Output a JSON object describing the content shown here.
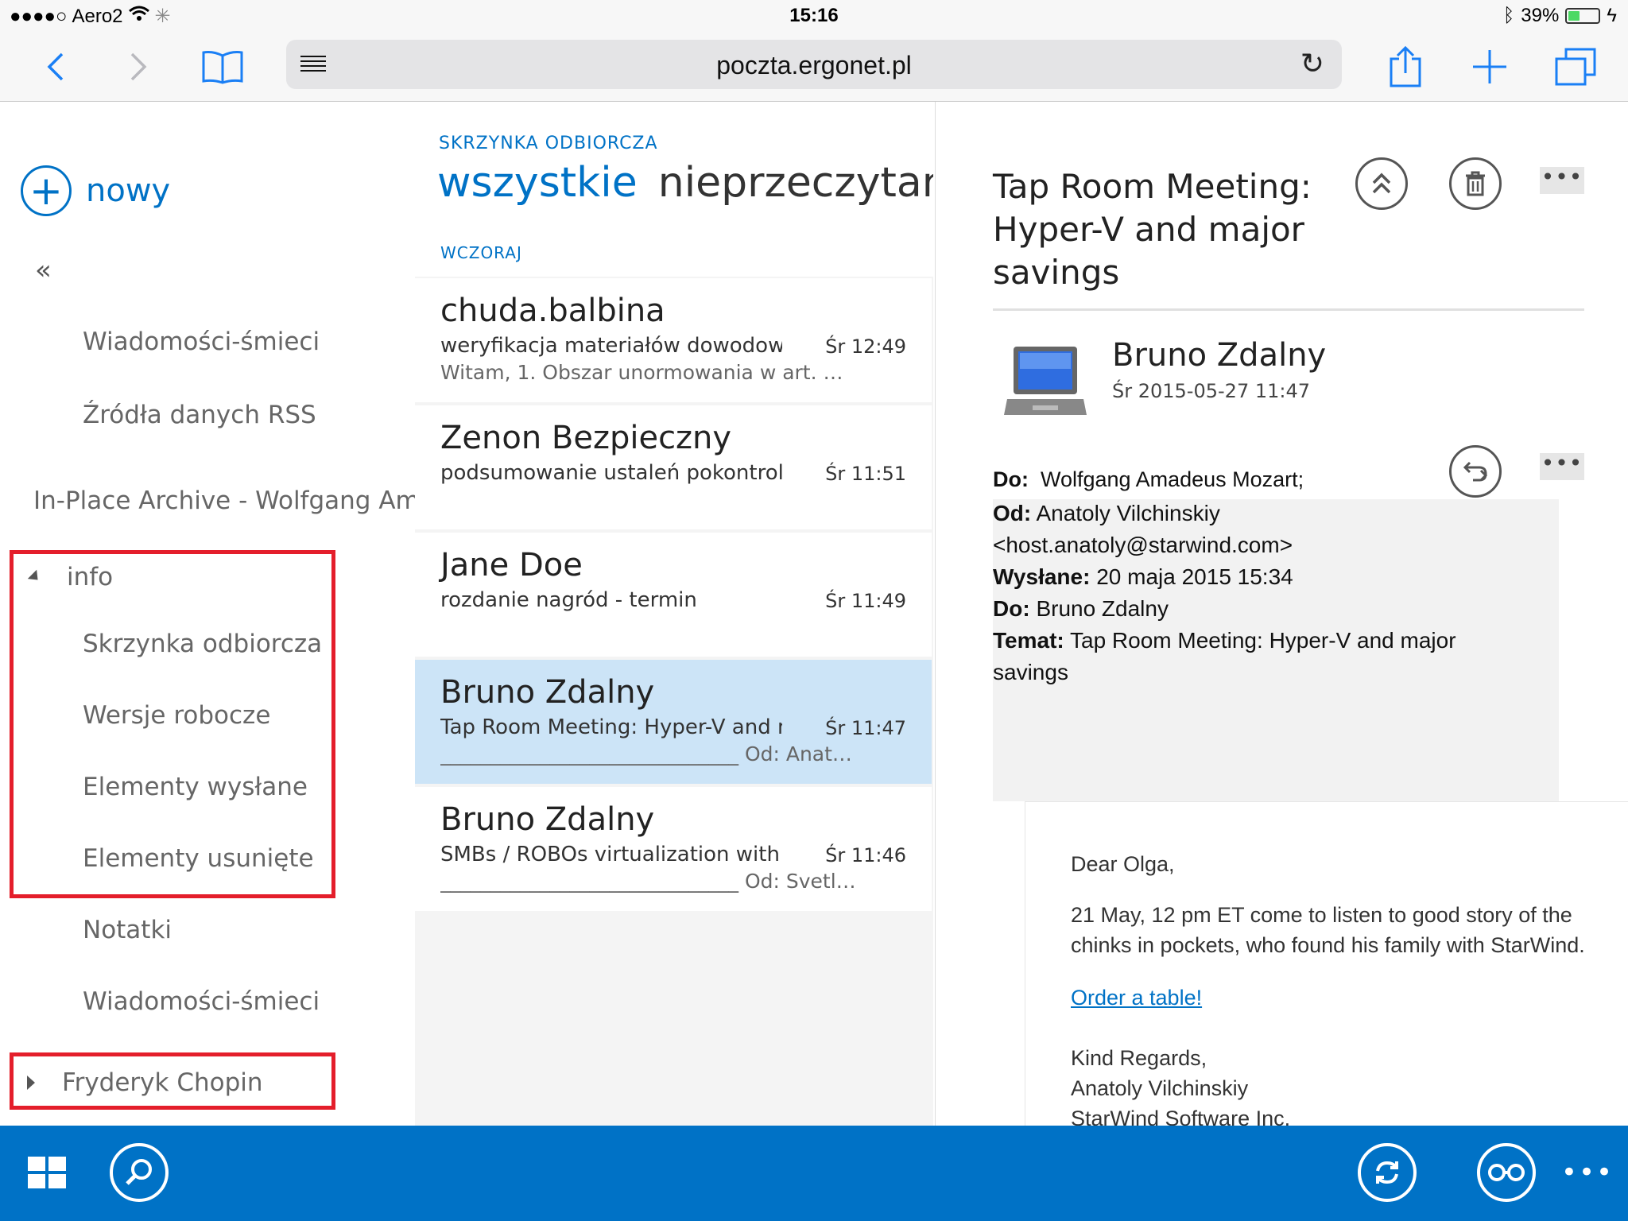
{
  "status_bar": {
    "carrier": "Aero2",
    "signal": "●●●●○",
    "time": "15:16",
    "battery_percent": "39%",
    "battery_level": 0.39
  },
  "browser": {
    "url": "poczta.ergonet.pl"
  },
  "left_pane": {
    "new_label": "nowy",
    "collapse_glyph": "«",
    "top_folders": [
      "Wiadomości-śmieci",
      "Źródła danych RSS"
    ],
    "archive_label": "In-Place Archive - Wolfgang Amadeus Mozart",
    "info_group": {
      "label": "info",
      "folders": [
        "Skrzynka odbiorcza",
        "Wersje robocze",
        "Elementy wysłane",
        "Elementy usunięte",
        "Notatki",
        "Wiadomości-śmieci"
      ]
    },
    "chopin_group": {
      "label": "Fryderyk Chopin"
    }
  },
  "mail_list": {
    "inbox_title": "SKRZYNKA ODBIORCZA",
    "filter_all": "wszystkie",
    "filter_unread": "nieprzeczytane",
    "group_label": "WCZORAJ",
    "items": [
      {
        "from": "chuda.balbina",
        "subject": "weryfikacja materiałów dowodowych",
        "time": "Śr 12:49",
        "preview": "Witam,   1. Obszar unormowania w art. …"
      },
      {
        "from": "Zenon Bezpieczny",
        "subject": "podsumowanie ustaleń pokontrolnych",
        "time": "Śr 11:51",
        "preview": ""
      },
      {
        "from": "Jane Doe",
        "subject": "rozdanie nagród - termin",
        "time": "Śr 11:49",
        "preview": ""
      },
      {
        "from": "Bruno Zdalny",
        "subject": "Tap Room Meeting: Hyper-V and major savings",
        "time": "Śr 11:47",
        "preview": "______________________________ Od: Anat…"
      },
      {
        "from": "Bruno Zdalny",
        "subject": "SMBs / ROBOs virtualization with Hyper-V",
        "time": "Śr 11:46",
        "preview": "______________________________ Od: Svetl…"
      }
    ]
  },
  "reading_pane": {
    "subject": "Tap Room Meeting: Hyper-V and major savings",
    "sender": "Bruno Zdalny",
    "date": "Śr 2015-05-27 11:47",
    "to_label": "Do:",
    "to_value": "Wolfgang Amadeus Mozart;",
    "dots": "•••",
    "headers": [
      {
        "label": "Od:",
        "value": "Anatoly Vilchinskiy <host.anatoly@starwind.com>"
      },
      {
        "label": "Wysłane:",
        "value": "20 maja 2015 15:34"
      },
      {
        "label": "Do:",
        "value": "Bruno Zdalny"
      },
      {
        "label": "Temat:",
        "value": "Tap Room Meeting: Hyper-V and major savings"
      }
    ],
    "body": {
      "greeting": "Dear Olga,",
      "paragraph": "21 May, 12 pm ET come to listen to good story of the chinks in pockets, who found his family with StarWind.",
      "link": "Order a table!",
      "regards": "Kind Regards,",
      "signature_name": "Anatoly Vilchinskiy",
      "signature_company": "StarWind Software Inc."
    }
  }
}
